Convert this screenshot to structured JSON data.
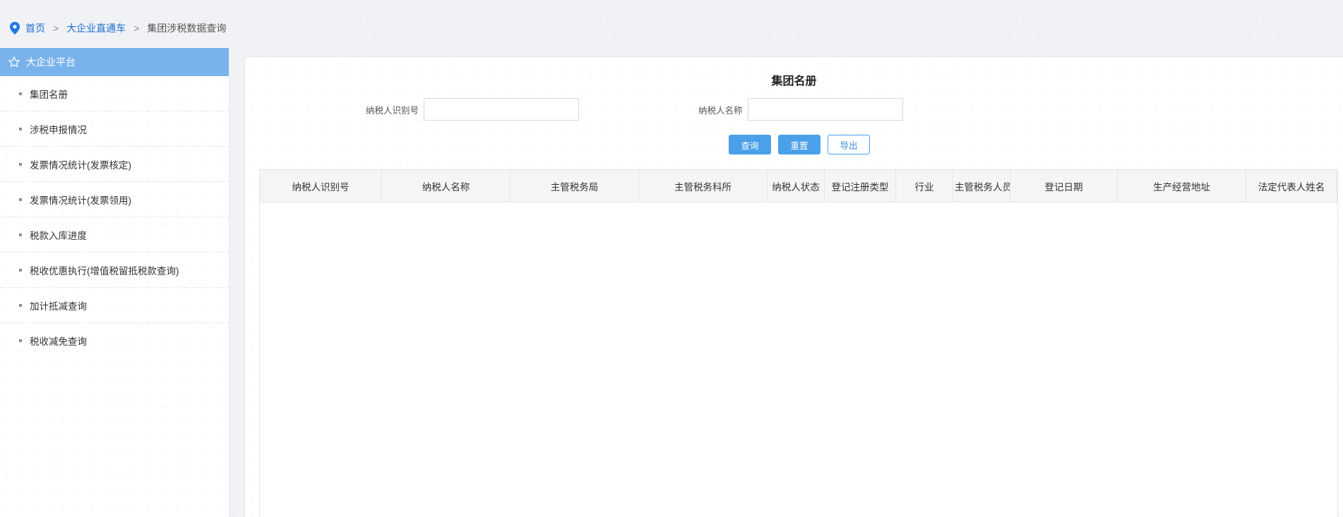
{
  "breadcrumb": {
    "home": "首页",
    "section": "大企业直通车",
    "current": "集团涉税数据查询",
    "separator": ">"
  },
  "sidebar": {
    "title": "大企业平台",
    "items": [
      {
        "label": "集团名册"
      },
      {
        "label": "涉税申报情况"
      },
      {
        "label": "发票情况统计(发票核定)"
      },
      {
        "label": "发票情况统计(发票领用)"
      },
      {
        "label": "税款入库进度"
      },
      {
        "label": "税收优惠执行(增值税留抵税款查询)"
      },
      {
        "label": "加计抵减查询"
      },
      {
        "label": "税收减免查询"
      }
    ]
  },
  "main": {
    "title": "集团名册",
    "form": {
      "taxpayer_id_label": "纳税人识别号",
      "taxpayer_id_value": "",
      "taxpayer_name_label": "纳税人名称",
      "taxpayer_name_value": ""
    },
    "buttons": {
      "query": "查询",
      "reset": "重置",
      "export": "导出"
    },
    "table": {
      "columns": [
        "纳税人识别号",
        "纳税人名称",
        "主管税务局",
        "主管税务科所",
        "纳税人状态",
        "登记注册类型",
        "行业",
        "主管税务人员",
        "登记日期",
        "生产经营地址",
        "法定代表人姓名"
      ],
      "rows": []
    }
  },
  "colors": {
    "link": "#1f6fd1",
    "sidebar_header": "#7ab3ec",
    "primary_button": "#4ba0ea"
  },
  "icons": {
    "breadcrumb": "location-pin-icon",
    "sidebar_header": "star-icon"
  }
}
